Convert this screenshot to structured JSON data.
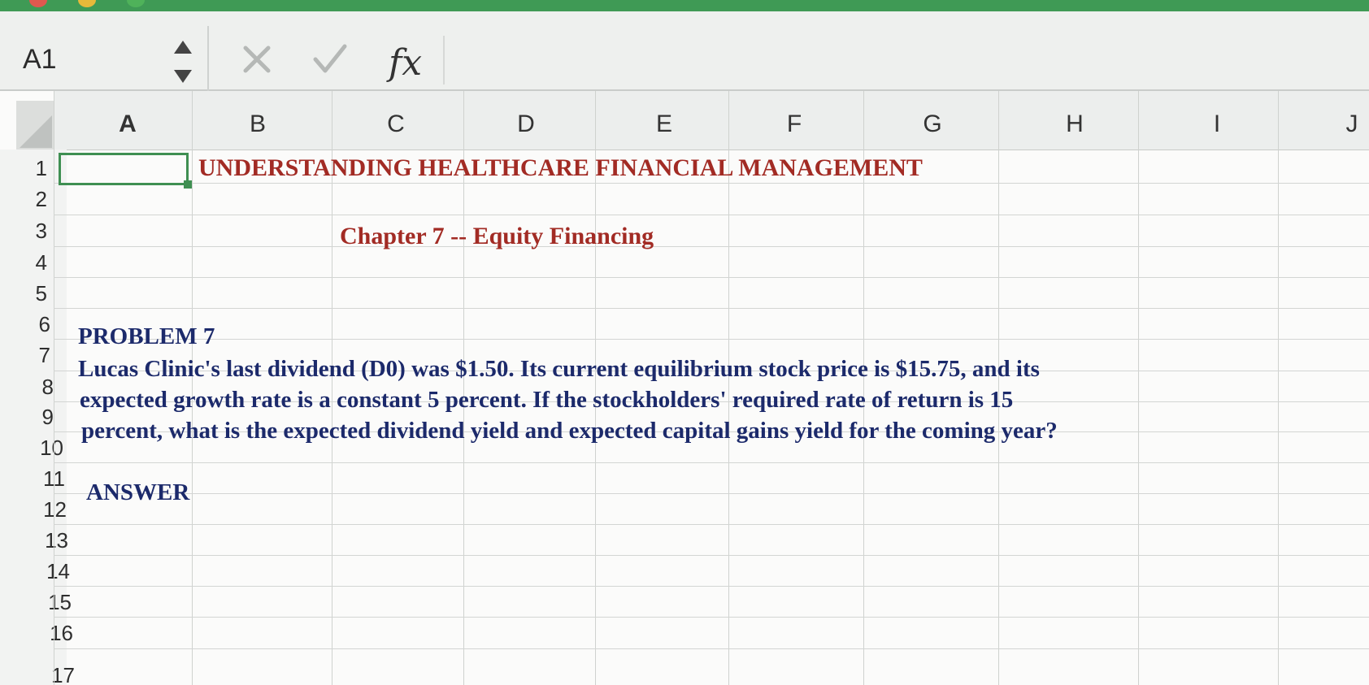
{
  "formula_bar": {
    "name_box": "A1",
    "cancel_icon": "x-icon",
    "enter_icon": "check-icon",
    "function_label": "fx",
    "formula_value": ""
  },
  "columns": [
    "A",
    "B",
    "C",
    "D",
    "E",
    "F",
    "G",
    "H",
    "I",
    "J"
  ],
  "rows": [
    "1",
    "2",
    "3",
    "4",
    "5",
    "6",
    "7",
    "8",
    "9",
    "10",
    "11",
    "12",
    "13",
    "14",
    "15",
    "16",
    "17"
  ],
  "cells": {
    "b1": "UNDERSTANDING HEALTHCARE FINANCIAL MANAGEMENT",
    "c3": "Chapter 7 -- Equity Financing",
    "a6": "PROBLEM  7",
    "a7": "Lucas Clinic's last dividend (D0) was $1.50. Its current equilibrium stock price is $15.75, and its",
    "a8": "expected growth rate is a constant 5 percent. If the stockholders' required rate of return is 15",
    "a9": "percent, what is the expected dividend yield and expected capital gains yield for the coming year?",
    "a11": "ANSWER"
  },
  "selected_cell": "A1",
  "colors": {
    "title_red": "#a22b24",
    "text_navy": "#1c2a6b",
    "selection_green": "#3f8f52",
    "titlebar_green": "#3f9a55"
  }
}
